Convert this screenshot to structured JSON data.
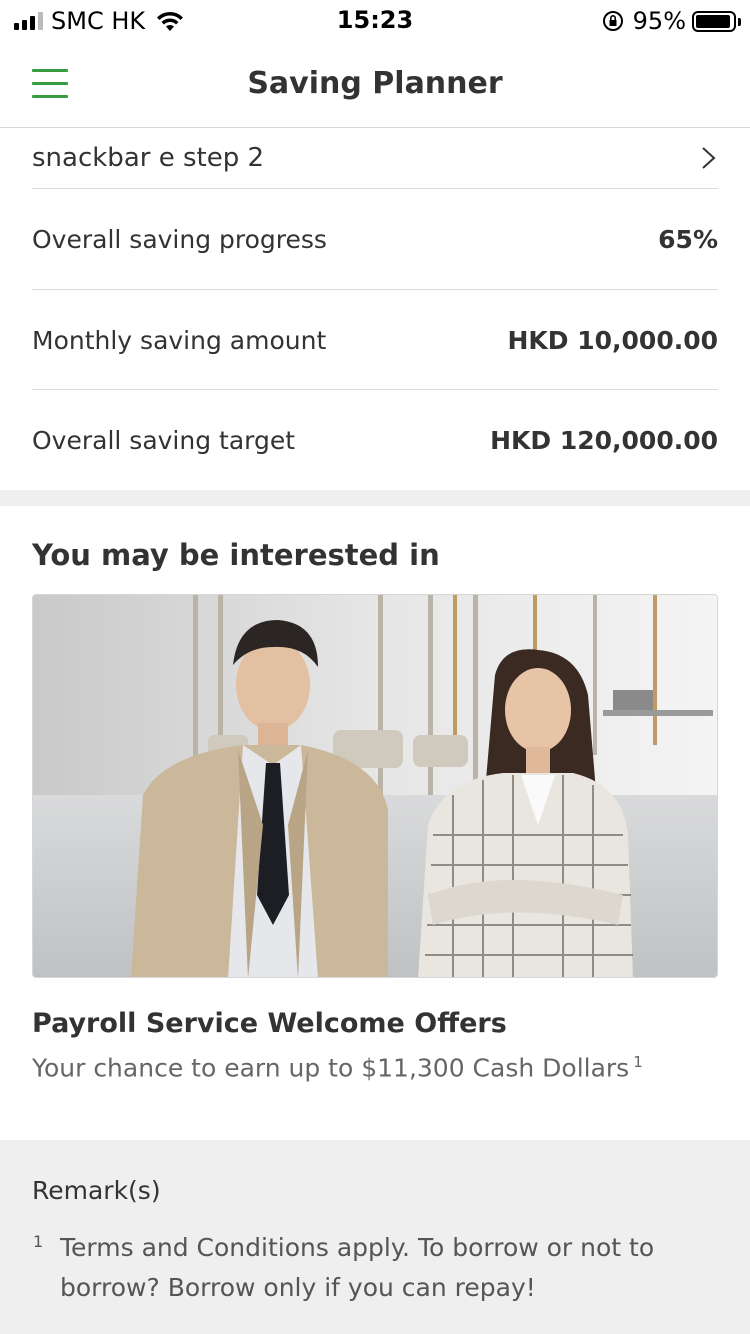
{
  "status_bar": {
    "carrier": "SMC HK",
    "time": "15:23",
    "battery_percent": "95%",
    "battery_level": 0.95
  },
  "nav": {
    "title": "Saving Planner",
    "menu_icon": "hamburger-menu-icon",
    "accent_color": "#3a9c41"
  },
  "plan": {
    "name": "snackbar e step 2",
    "rows": [
      {
        "label": "Overall saving progress",
        "value": "65%"
      },
      {
        "label": "Monthly saving amount",
        "value": "HKD 10,000.00"
      },
      {
        "label": "Overall saving target",
        "value": "HKD 120,000.00"
      }
    ]
  },
  "promo": {
    "heading": "You may be interested in",
    "title": "Payroll Service Welcome Offers",
    "description": "Your chance to earn up to $11,300 Cash Dollars",
    "footnote_ref": "1"
  },
  "remarks": {
    "title": "Remark(s)",
    "items": [
      {
        "num": "1",
        "text": "Terms and Conditions apply. To borrow or not to borrow? Borrow only if you can repay!"
      }
    ]
  }
}
